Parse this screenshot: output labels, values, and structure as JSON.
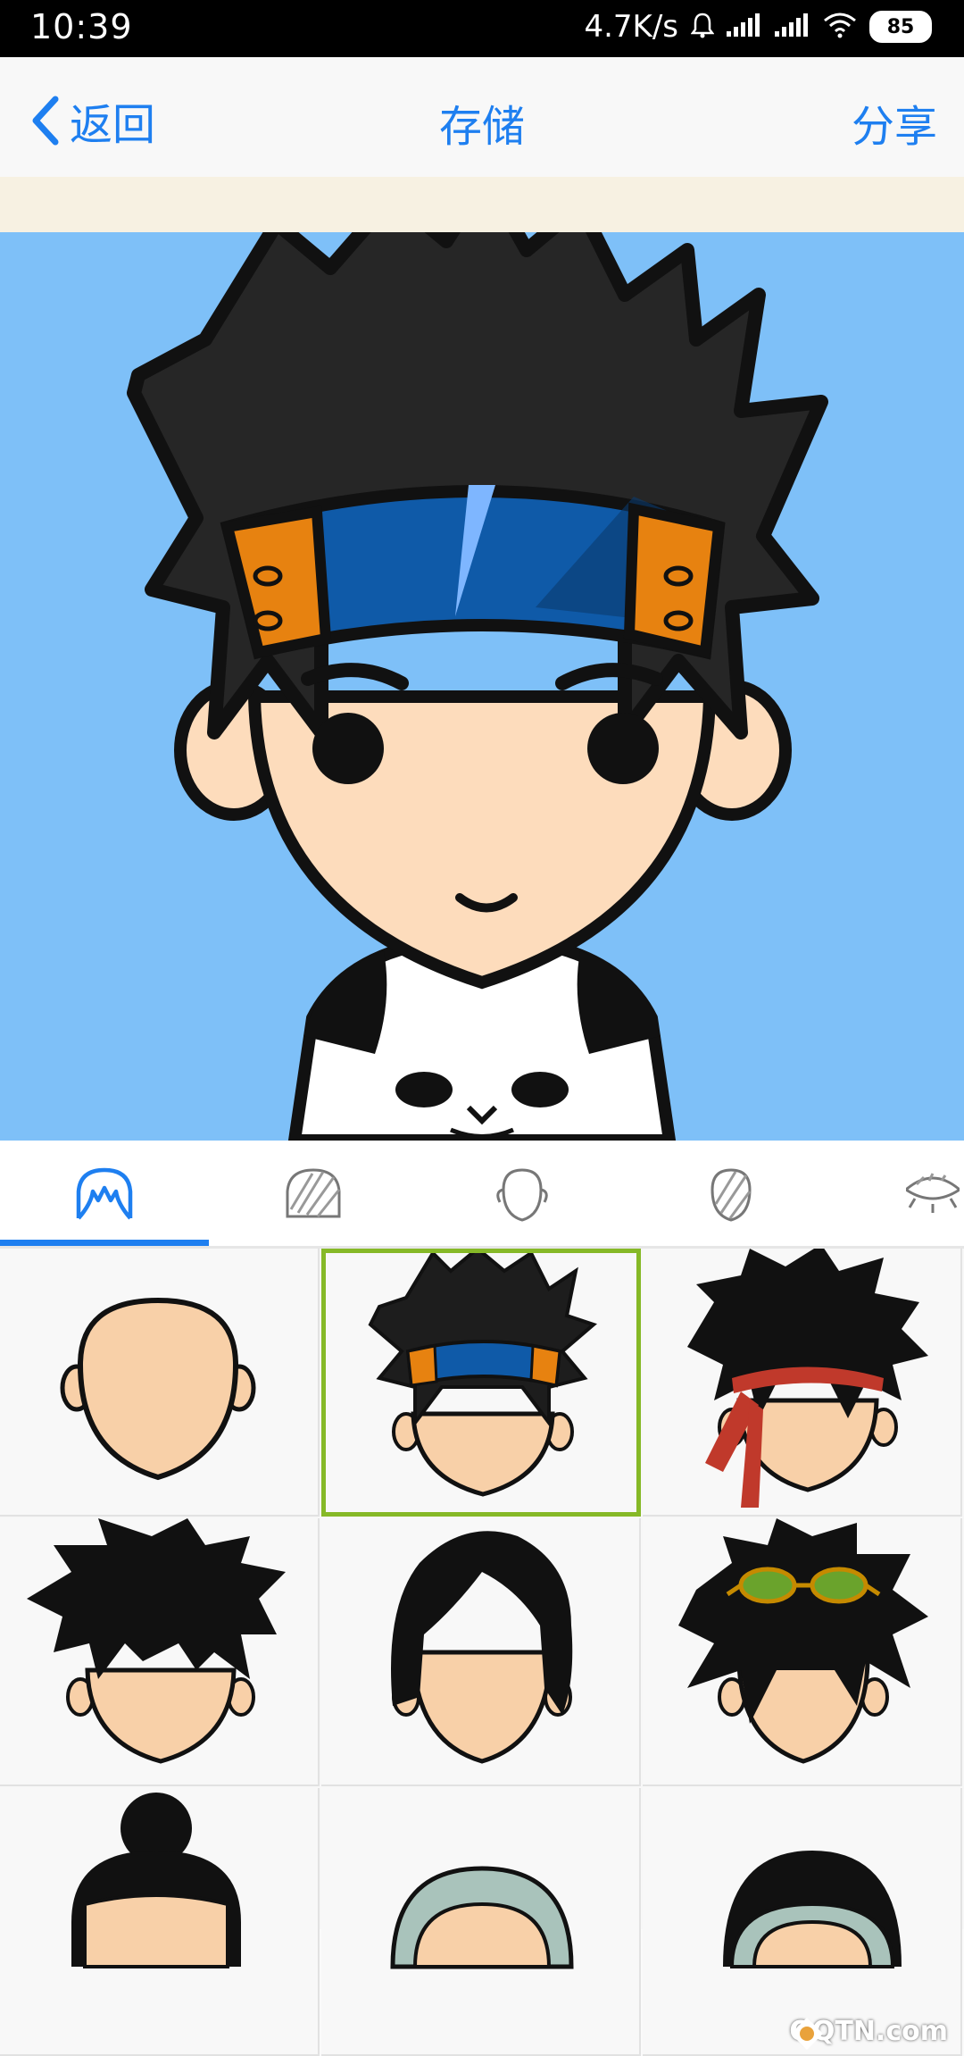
{
  "status_bar": {
    "time": "10:39",
    "net_speed": "4.7K/s",
    "battery": "85",
    "icons": [
      "bell-icon",
      "signal-icon",
      "signal-icon",
      "wifi-icon",
      "battery-icon"
    ]
  },
  "nav": {
    "back_label": "返回",
    "title": "存储",
    "share_label": "分享",
    "accent": "#1e7ff0"
  },
  "preview": {
    "background": "#7ec0f8"
  },
  "tabs": [
    {
      "icon": "hair-outline-icon",
      "selected": true
    },
    {
      "icon": "hair-shaded-icon",
      "selected": false
    },
    {
      "icon": "face-outline-icon",
      "selected": false
    },
    {
      "icon": "face-shaded-icon",
      "selected": false
    },
    {
      "icon": "eye-icon",
      "selected": false
    }
  ],
  "grid": {
    "selected_index": 1,
    "selection_color": "#86b927",
    "items": [
      {
        "name": "bald"
      },
      {
        "name": "spiky-headband"
      },
      {
        "name": "messy-red-bandana"
      },
      {
        "name": "wild-messy"
      },
      {
        "name": "side-part"
      },
      {
        "name": "spiky-goggles"
      },
      {
        "name": "bun"
      },
      {
        "name": "gray-helmet"
      },
      {
        "name": "short-gray"
      }
    ]
  },
  "watermark": {
    "text": "QQTN.com"
  }
}
